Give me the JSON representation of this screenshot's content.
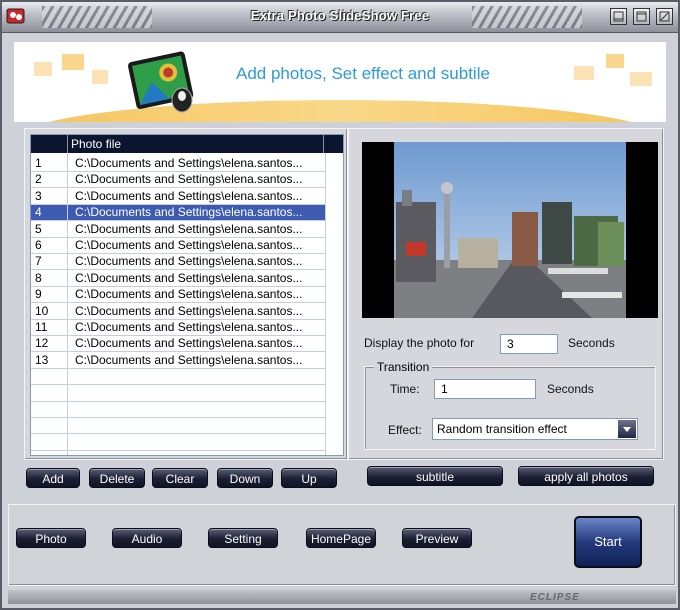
{
  "window": {
    "title": "Extra Photo SlideShow Free"
  },
  "banner": {
    "headline": "Add photos, Set effect and subtile"
  },
  "photo_list": {
    "column_header": "Photo file",
    "rows": [
      {
        "num": "1",
        "path": "C:\\Documents and Settings\\elena.santos..."
      },
      {
        "num": "2",
        "path": "C:\\Documents and Settings\\elena.santos..."
      },
      {
        "num": "3",
        "path": "C:\\Documents and Settings\\elena.santos..."
      },
      {
        "num": "4",
        "path": "C:\\Documents and Settings\\elena.santos..."
      },
      {
        "num": "5",
        "path": "C:\\Documents and Settings\\elena.santos..."
      },
      {
        "num": "6",
        "path": "C:\\Documents and Settings\\elena.santos..."
      },
      {
        "num": "7",
        "path": "C:\\Documents and Settings\\elena.santos..."
      },
      {
        "num": "8",
        "path": "C:\\Documents and Settings\\elena.santos..."
      },
      {
        "num": "9",
        "path": "C:\\Documents and Settings\\elena.santos..."
      },
      {
        "num": "10",
        "path": "C:\\Documents and Settings\\elena.santos..."
      },
      {
        "num": "11",
        "path": "C:\\Documents and Settings\\elena.santos..."
      },
      {
        "num": "12",
        "path": "C:\\Documents and Settings\\elena.santos..."
      },
      {
        "num": "13",
        "path": "C:\\Documents and Settings\\elena.santos..."
      }
    ],
    "selected_row": "4"
  },
  "list_buttons": {
    "add": "Add",
    "delete": "Delete",
    "clear": "Clear",
    "down": "Down",
    "up": "Up"
  },
  "settings": {
    "display_label": "Display the photo for",
    "display_value": "3",
    "display_unit": "Seconds",
    "transition_legend": "Transition",
    "time_label": "Time:",
    "time_value": "1",
    "time_unit": "Seconds",
    "effect_label": "Effect:",
    "effect_value": "Random transition effect",
    "subtitle_button": "subtitle",
    "apply_button": "apply all photos"
  },
  "nav_buttons": {
    "photo": "Photo",
    "audio": "Audio",
    "setting": "Setting",
    "homepage": "HomePage",
    "preview": "Preview",
    "start": "Start"
  },
  "footer": {
    "brand": "ECLIPSE"
  },
  "colors": {
    "accent_blue": "#2d9ad9",
    "selection": "#3d5bb0",
    "button_dark": "#1b1f33"
  }
}
